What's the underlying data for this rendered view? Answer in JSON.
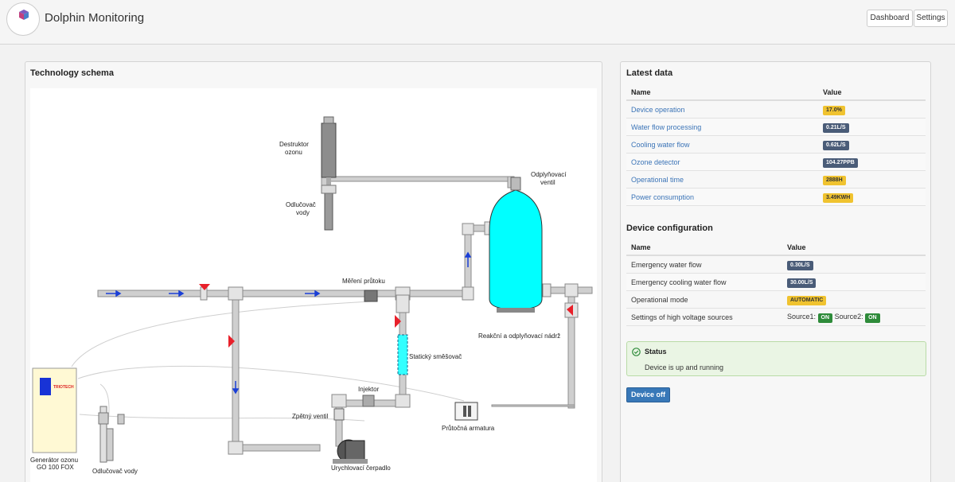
{
  "header": {
    "title": "Dolphin Monitoring",
    "nav": [
      {
        "label": "Dashboard"
      },
      {
        "label": "Settings"
      }
    ]
  },
  "schema": {
    "title": "Technology schema",
    "labels": {
      "destruktor": [
        "Destruktor",
        "ozonu"
      ],
      "odlucovac_top": [
        "Odlučovač",
        "vody"
      ],
      "odplynovaci_ventil": [
        "Odplyňovací",
        "ventil"
      ],
      "mereni_prutoku": "Měření průtoku",
      "reakcni": "Reakční a odplyňovací nádrž",
      "staticky": "Statický směšovač",
      "injektor": "Injektor",
      "zpetny": "Zpětný ventil",
      "prutocna": "Průtočná armatura",
      "generator": [
        "Generátor ozonu",
        "GO 100 FOX"
      ],
      "odlucovac_bottom": "Odlučovač vody",
      "cerpadlo": "Urychlovací čerpadlo",
      "brand_on_generator": "TRIOTECH"
    }
  },
  "latest": {
    "title": "Latest data",
    "col_name": "Name",
    "col_value": "Value",
    "rows": [
      {
        "name": "Device operation",
        "value": "17.0%",
        "style": "warn"
      },
      {
        "name": "Water flow processing",
        "value": "0.21L/S",
        "style": "dark"
      },
      {
        "name": "Cooling water flow",
        "value": "0.62L/S",
        "style": "dark"
      },
      {
        "name": "Ozone detector",
        "value": "104.27PPB",
        "style": "dark"
      },
      {
        "name": "Operational time",
        "value": "2888H",
        "style": "warn"
      },
      {
        "name": "Power consumption",
        "value": "3.49KWH",
        "style": "warn"
      }
    ]
  },
  "config": {
    "title": "Device configuration",
    "col_name": "Name",
    "col_value": "Value",
    "rows": [
      {
        "name": "Emergency water flow",
        "value": "0.30L/S",
        "style": "dark"
      },
      {
        "name": "Emergency cooling water flow",
        "value": "30.00L/S",
        "style": "dark"
      },
      {
        "name": "Operational mode",
        "value": "AUTOMATIC",
        "style": "warn"
      }
    ],
    "hv": {
      "name": "Settings of high voltage sources",
      "source1_label": "Source1:",
      "source1_value": "ON",
      "source2_label": "Source2:",
      "source2_value": "ON"
    }
  },
  "status": {
    "title": "Status",
    "text": "Device is up and running"
  },
  "device_button": {
    "label": "Device off"
  },
  "colors": {
    "tank": "#00ffff",
    "pipe": "#c8c8c8",
    "valve": "#e8202a",
    "label_warn": "#f0c330",
    "label_dark": "#4a5c78",
    "label_green": "#2e8b3a",
    "button": "#3878b8"
  }
}
